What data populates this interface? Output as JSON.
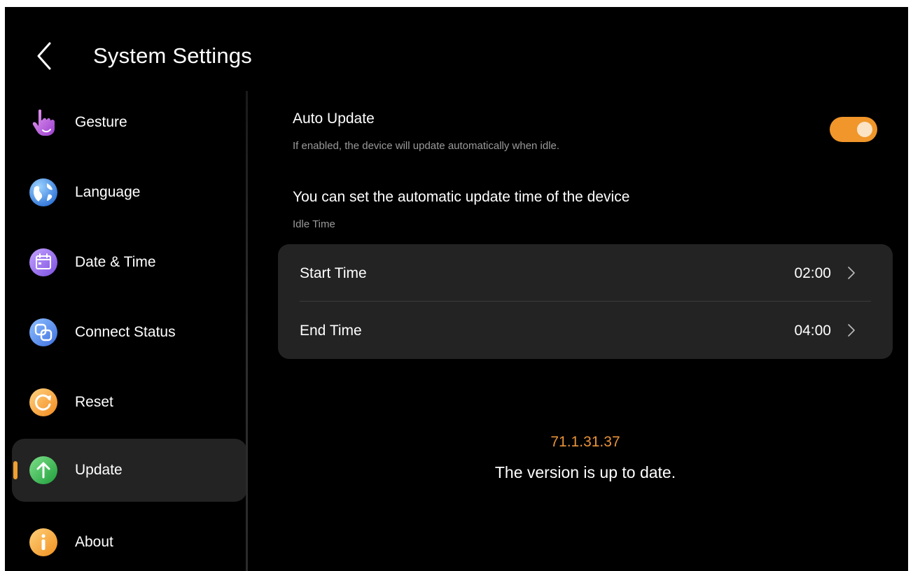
{
  "header": {
    "title": "System Settings",
    "back_icon": "chevron-left-icon"
  },
  "sidebar": {
    "items": [
      {
        "label": "Gesture",
        "icon": "hand-pointer-icon",
        "active": false
      },
      {
        "label": "Language",
        "icon": "globe-icon",
        "active": false
      },
      {
        "label": "Date & Time",
        "icon": "calendar-icon",
        "active": false
      },
      {
        "label": "Connect Status",
        "icon": "link-icon",
        "active": false
      },
      {
        "label": "Reset",
        "icon": "reset-icon",
        "active": false
      },
      {
        "label": "Update",
        "icon": "arrow-up-icon",
        "active": true
      },
      {
        "label": "About",
        "icon": "info-icon",
        "active": false
      }
    ]
  },
  "main": {
    "auto_update": {
      "title": "Auto Update",
      "description": "If enabled, the device will update automatically when idle.",
      "enabled": true
    },
    "schedule_text": "You can set the automatic update time of the device",
    "idle_label": "Idle Time",
    "times": [
      {
        "label": "Start Time",
        "value": "02:00"
      },
      {
        "label": "End Time",
        "value": "04:00"
      }
    ],
    "version": "71.1.31.37",
    "status": "The version is up to date."
  },
  "colors": {
    "accent": "#f0962a",
    "version_text": "#e8923a",
    "background": "#000000",
    "card": "#232323"
  }
}
